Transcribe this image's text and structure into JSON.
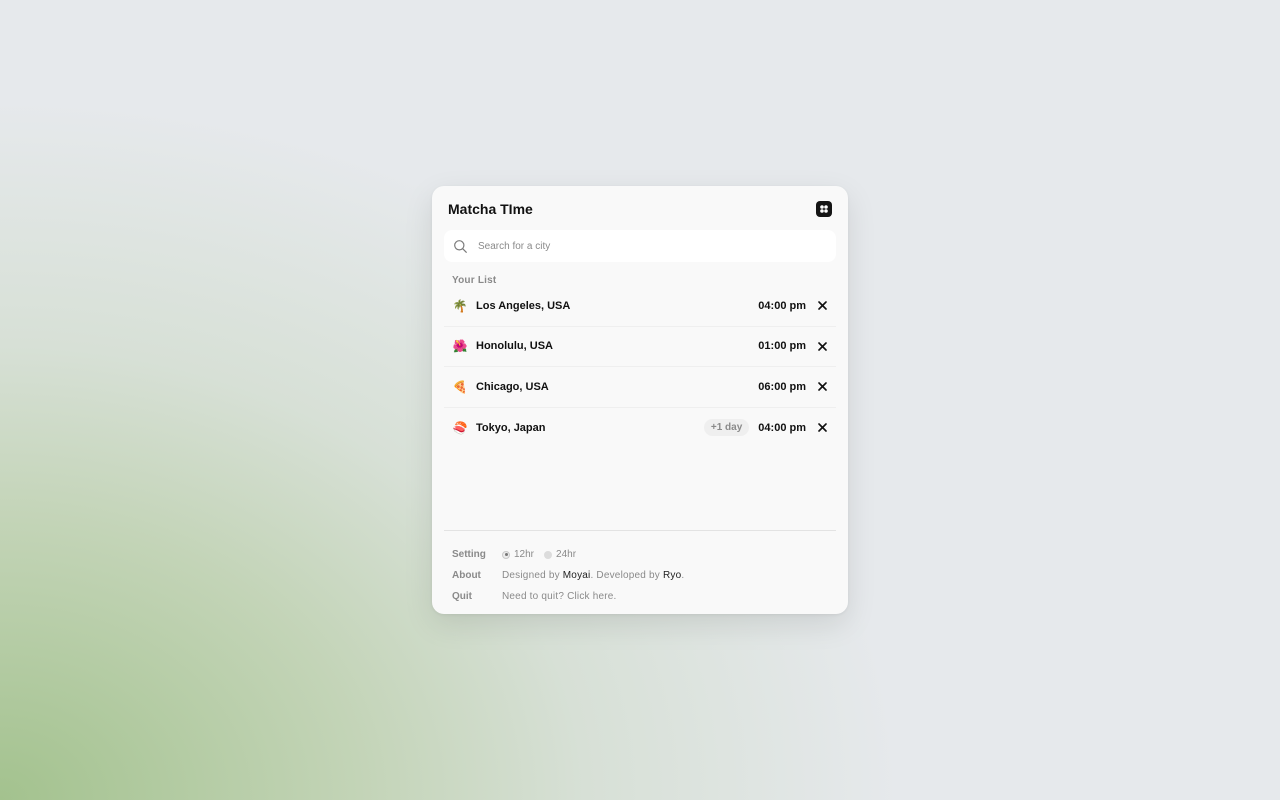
{
  "app": {
    "title": "Matcha TIme"
  },
  "search": {
    "placeholder": "Search for a city"
  },
  "list": {
    "label": "Your List",
    "items": [
      {
        "emoji": "🌴",
        "city": "Los Angeles, USA",
        "badge": "",
        "time": "04:00 pm"
      },
      {
        "emoji": "🌺",
        "city": "Honolulu, USA",
        "badge": "",
        "time": "01:00 pm"
      },
      {
        "emoji": "🍕",
        "city": "Chicago, USA",
        "badge": "",
        "time": "06:00 pm"
      },
      {
        "emoji": "🍣",
        "city": "Tokyo, Japan",
        "badge": "+1 day",
        "time": "04:00 pm"
      }
    ]
  },
  "footer": {
    "setting_label": "Setting",
    "option_12": "12hr",
    "option_24": "24hr",
    "selected_format": "12hr",
    "about_label": "About",
    "about_prefix": "Designed by ",
    "designer": "Moyai",
    "about_middle": ". Developed by ",
    "developer": "Ryo",
    "about_suffix": ".",
    "quit_label": "Quit",
    "quit_text": "Need to quit? Click here."
  },
  "icons": {
    "app": "app-logo-icon",
    "search": "search-icon",
    "remove": "close-icon"
  }
}
